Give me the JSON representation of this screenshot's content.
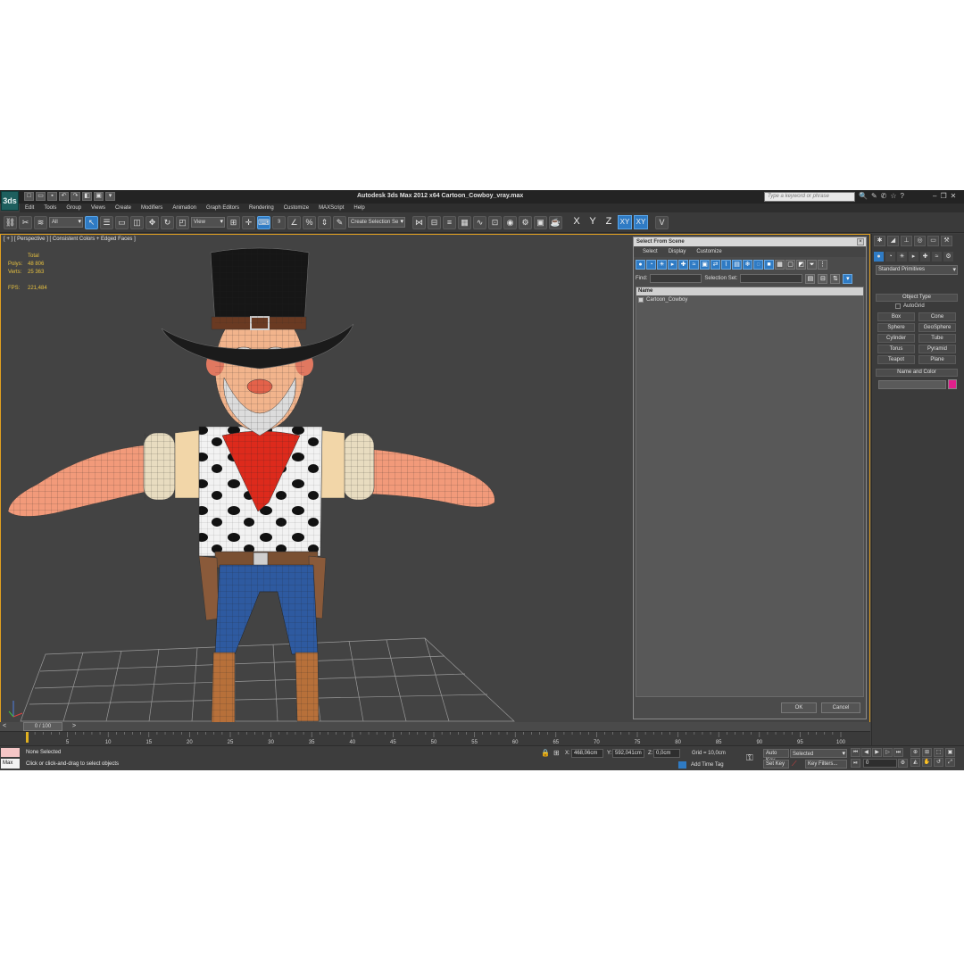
{
  "app": {
    "logo": "3ds",
    "title": "Autodesk 3ds Max  2012 x64     Cartoon_Cowboy_vray.max",
    "search_placeholder": "Type a keyword or phrase"
  },
  "menu": [
    "Edit",
    "Tools",
    "Group",
    "Views",
    "Create",
    "Modifiers",
    "Animation",
    "Graph Editors",
    "Rendering",
    "Customize",
    "MAXScript",
    "Help"
  ],
  "toolbar": {
    "selection_filter": "All",
    "ref_coord": "View",
    "named_selection_placeholder": "Create Selection Se",
    "axis_x": "X",
    "axis_y": "Y",
    "axis_z": "Z",
    "axis_xy": "XY",
    "axis_xy2": "XY"
  },
  "viewport": {
    "label": "[ + ] [ Perspective ] [ Consistent Colors + Edged Faces ]",
    "stats": {
      "total_label": "Total",
      "polys_label": "Polys:",
      "polys_value": "48 806",
      "verts_label": "Verts:",
      "verts_value": "25 363",
      "fps_label": "FPS:",
      "fps_value": "221,484"
    }
  },
  "dialog": {
    "title": "Select From Scene",
    "menu": [
      "Select",
      "Display",
      "Customize"
    ],
    "find_label": "Find:",
    "selection_set_label": "Selection Set:",
    "column_name": "Name",
    "items": [
      "Cartoon_Cowboy"
    ],
    "ok": "OK",
    "cancel": "Cancel"
  },
  "command_panel": {
    "category": "Standard Primitives",
    "object_type_title": "Object Type",
    "autogrid_label": "AutoGrid",
    "primitives": [
      "Box",
      "Cone",
      "Sphere",
      "GeoSphere",
      "Cylinder",
      "Tube",
      "Torus",
      "Pyramid",
      "Teapot",
      "Plane"
    ],
    "name_color_title": "Name and Color",
    "object_color": "#e0208c"
  },
  "timeline": {
    "position": "0 / 100",
    "ticks": [
      "0",
      "5",
      "10",
      "15",
      "20",
      "25",
      "30",
      "35",
      "40",
      "45",
      "50",
      "55",
      "60",
      "65",
      "70",
      "75",
      "80",
      "85",
      "90",
      "95",
      "100"
    ]
  },
  "status": {
    "maxscript": "Max",
    "selection": "None Selected",
    "prompt": "Click or click-and-drag to select objects",
    "x_label": "X:",
    "x_value": "468,06cm",
    "y_label": "Y:",
    "y_value": "592,041cm",
    "z_label": "Z:",
    "z_value": "0,0cm",
    "grid": "Grid = 10,0cm",
    "add_time_tag": "Add Time Tag",
    "auto_key": "Auto Key",
    "set_key": "Set Key",
    "key_mode": "Selected",
    "key_filters": "Key Filters...",
    "frame": "0"
  },
  "colors": {
    "accent": "#2f7bc4",
    "viewport_border": "#e0a020",
    "stats_text": "#e6c040"
  }
}
